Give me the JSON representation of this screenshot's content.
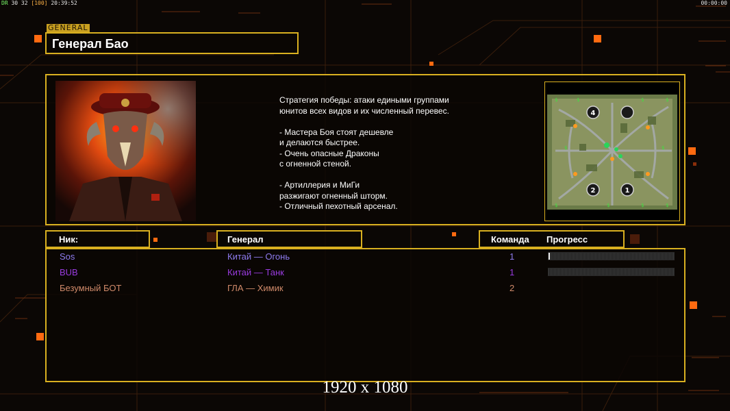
{
  "hud": {
    "left_a": "DR",
    "left_b": "30 32",
    "left_c": "[100]",
    "left_d": "20:39:52",
    "right": "00:00:00"
  },
  "header": {
    "tag": "GENERAL",
    "title": "Генерал Бао"
  },
  "info": {
    "description": "Стратегия победы: атаки едиными группами\nюнитов всех видов и их численный перевес.\n\n- Мастера Боя стоят дешевле\nи делаются быстрее.\n- Очень опасные Драконы\nс огненной стеной.\n\n- Артиллерия и МиГи\nразжигают огненный шторм.\n- Отличный пехотный арсенал.",
    "map_markers": [
      "4",
      "2",
      "1"
    ]
  },
  "columns": {
    "nick": "Ник:",
    "general": "Генерал",
    "team": "Команда",
    "progress": "Прогресс"
  },
  "players": [
    {
      "nick": "Sos",
      "general": "Китай — Огонь",
      "team": "1",
      "progress": 0.01,
      "color": "#8f7cf0"
    },
    {
      "nick": "BUB",
      "general": "Китай — Танк",
      "team": "1",
      "progress": 0.0,
      "color": "#9a3be0"
    },
    {
      "nick": "Безумный БОТ",
      "general": "ГЛА — Химик",
      "team": "2",
      "progress": null,
      "color": "#d08a6a"
    }
  ],
  "resolution": "1920 x 1080",
  "colors": {
    "accent": "#d9b020",
    "hud_green": "#7cff6a",
    "orange_square": "#ff6a10"
  }
}
